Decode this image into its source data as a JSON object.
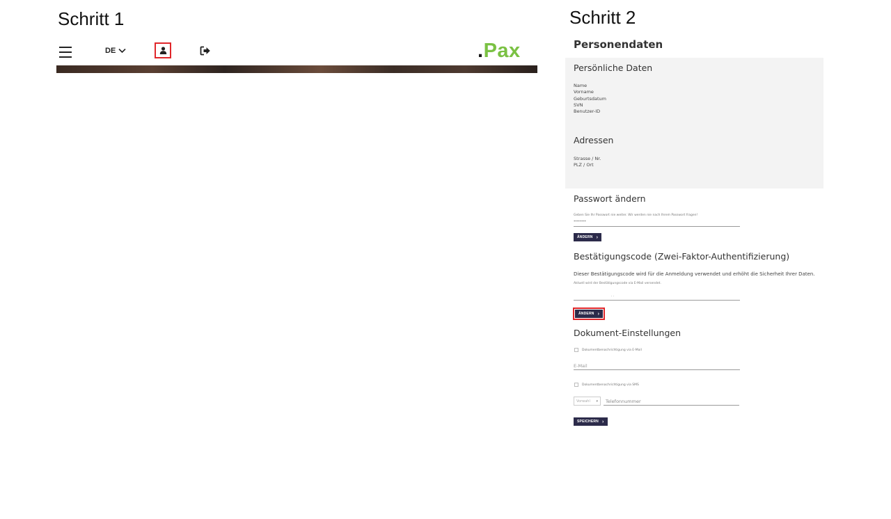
{
  "step1": {
    "title": "Schritt 1",
    "nav": {
      "lang_label": "DE",
      "logo_dot": ".",
      "logo_text": "Pax"
    }
  },
  "step2": {
    "title": "Schritt 2",
    "heading": "Personendaten",
    "personal": {
      "heading": "Persönliche Daten",
      "fields": [
        "Name",
        "Vorname",
        "Geburtsdatum",
        "SVN",
        "Benutzer-ID"
      ]
    },
    "addresses": {
      "heading": "Adressen",
      "fields": [
        "Strasse / Nr.",
        "PLZ / Ort"
      ]
    },
    "password": {
      "heading": "Passwort ändern",
      "hint": "Geben Sie Ihr Passwort nie weiter. Wir werden nie nach Ihrem Passwort fragen!",
      "value": "********",
      "button": "ÄNDERN"
    },
    "twofactor": {
      "heading": "Bestätigungscode (Zwei-Faktor-Authentifizierung)",
      "description": "Dieser Bestätigungscode wird für die Anmeldung verwendet und erhöht die Sicherheit Ihrer Daten.",
      "note": "Aktuell wird der Bestätigungscode via E-Mail versendet.",
      "value": "· ·",
      "button": "ÄNDERN"
    },
    "documents": {
      "heading": "Dokument-Einstellungen",
      "email_checkbox_label": "Dokumentbenachrichtigung via E-Mail",
      "email_placeholder": "E-Mail",
      "sms_checkbox_label": "Dokumentbenachrichtigung via SMS",
      "country_select": "Vorwahl",
      "phone_placeholder": "Telefonnummer",
      "save_button": "SPEICHERN"
    }
  },
  "colors": {
    "highlight": "#e0262a",
    "logo_green": "#7ac143",
    "button_dark": "#2c2b4a",
    "panel_gray": "#f3f3f3"
  },
  "icons": {
    "menu": "hamburger-icon",
    "lang": "chevron-down-icon",
    "user": "user-icon",
    "logout": "logout-icon",
    "chevron": "chevron-right-icon"
  }
}
